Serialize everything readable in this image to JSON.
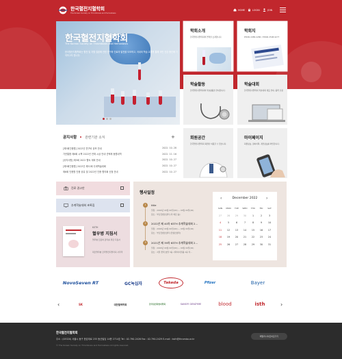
{
  "header": {
    "logo_ko": "한국혈전지혈학회",
    "logo_en": "The Korean Society on Thrombosis and Hemostasis",
    "util": [
      "HOME",
      "LOGIN",
      "JOIN"
    ]
  },
  "hero": {
    "title": "한국혈전지혈학회",
    "subtitle": "The Korean Society on Thrombosis and Hemostasis",
    "desc": "한국혈전지혈학회는 혈전 및 지혈 질환에 관한 연구와 진료의 발전을 도모하고, 국내외 학술 교류를 통해 국민 건강 증진에 기여하고자 합니다."
  },
  "tiles": [
    {
      "title": "학회소개",
      "desc": "한국혈전지혈학회의 연혁을 소개합니다."
    },
    {
      "title": "학회지",
      "desc": "PISSN 2288-4286 / EISSN 2508-9277"
    },
    {
      "title": "학술활동",
      "desc": "한국혈전지혈학회의 학술활동을 안내합니다."
    },
    {
      "title": "학술대회",
      "desc": "한국혈전지혈학회 학술대회 개요 안내, 등록 신청"
    },
    {
      "title": "회원공간",
      "desc": "한국혈전지혈학회 회원만 이용할 수 있습니다."
    },
    {
      "title": "마이페이지",
      "desc": "회원정보, 참여이력, 개인정보를 확인합니다."
    }
  ],
  "notice": {
    "tabs": [
      "공지사항",
      "관련기관 소식"
    ],
    "more": "+",
    "items": [
      {
        "title": "[제5회인증원] 2022년 연구비 공모 안내",
        "date": "2022. 10. 28"
      },
      {
        "title": "기관통합 제6회 시책 2022년 전체 시상 안내 선택제 동원내역",
        "date": "2022. 11. 16"
      },
      {
        "title": "[공지사항] 제5회 2022 혈녹 계획 안내",
        "date": "2022. 10. 27"
      },
      {
        "title": "[제5회인증원] 2022년 제52회 주계학술대회",
        "date": "2022. 10. 27"
      },
      {
        "title": "제6회 인증원 인증 공유 및 2022년 인증 협의회 신청 안내",
        "date": "2022. 10. 27"
      }
    ]
  },
  "quick": [
    {
      "label": "진료 권고안"
    },
    {
      "label": "추계학술대회 초록집"
    }
  ],
  "book": {
    "tag": "KSTH",
    "title": "혈우병 지침서",
    "desc": "혈우병 진료와 관리를 위한 지침서",
    "org": "대한혈우병 한국혈전지혈학회 사무국"
  },
  "schedule": {
    "title": "행사일정",
    "events": [
      {
        "num": "1",
        "title": "title",
        "date": "일정 : 2000년 00월 00일(00) ~ 00월 00일(00)",
        "place": "장소 : 부산컨벤션센터 [더 메인 홀]"
      },
      {
        "num": "2",
        "title": "2022년 제 40차 KSTH 추계학술대회 2...",
        "date": "일정 : 2000년 00월 00일(00) ~ 00월 00일(00)",
        "place": "장소 : 부산컨벤션센터 [컨벤션센터]"
      },
      {
        "num": "3",
        "title": "2021년 제 39차 KSTH 추계학술대회 2...",
        "date": "일정 : 2000년 00월 00일(00) ~ 00월 00일(00)",
        "place": "장소 : 서울 롯데 호텔 3층 사파이어볼룸 2층 학..."
      }
    ]
  },
  "calendar": {
    "month_label": "December 2022",
    "prev": "‹",
    "next": "›",
    "weekdays": [
      "SUN",
      "MON",
      "TUE",
      "WED",
      "THU",
      "FRI",
      "SAT"
    ],
    "weeks": [
      [
        "27",
        "28",
        "29",
        "30",
        "1",
        "2",
        "3"
      ],
      [
        "4",
        "5",
        "6",
        "7",
        "8",
        "9",
        "10"
      ],
      [
        "11",
        "12",
        "13",
        "14",
        "15",
        "16",
        "17"
      ],
      [
        "18",
        "19",
        "20",
        "21",
        "22",
        "23",
        "24"
      ],
      [
        "25",
        "26",
        "27",
        "28",
        "29",
        "30",
        "31"
      ]
    ]
  },
  "sponsors_row1": [
    "NovoSeven RT",
    "GC녹십자",
    "Takeda",
    "Pfizer",
    "Bayer"
  ],
  "sponsors_row2": [
    "SK",
    "대한혈액학회",
    "한국유전자변이학회",
    "SANOFI GENZYME",
    "blood",
    "isth"
  ],
  "footer": {
    "name": "한국혈전지혈학회",
    "address": "주소 : (05320) 서울시 동구 한강대로 235 동산빌딩 14층 2714호     Tel : 02-790-2426     Fax : 02-790-2429     E-mail : ksth@thrombo.or.kr",
    "copyright": "© The Korean Society on Thrombosis and Hemostasis All rights reserved.",
    "select_label": "패밀리사이트바로가기"
  },
  "colors": {
    "brand": "#c1272d",
    "footer": "#2c2c2c",
    "schedule_bg": "#eee5e0"
  }
}
